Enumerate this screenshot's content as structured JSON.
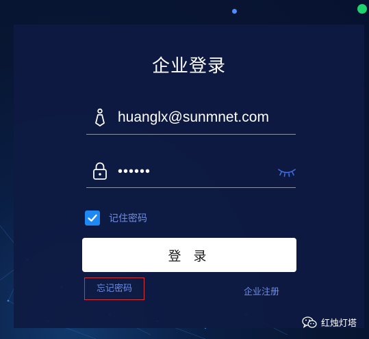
{
  "login": {
    "title": "企业登录",
    "username": {
      "value": "huanglx@sunmnet.com",
      "icon": "tie-user-icon"
    },
    "password": {
      "value": "••••••",
      "icon": "lock-icon",
      "toggle_icon": "eye-closed-icon"
    },
    "remember": {
      "label": "记住密码",
      "checked": true
    },
    "submit_label": "登 录",
    "forgot_label": "忘记密码",
    "register_label": "企业注册"
  },
  "watermark": {
    "label": "红烛灯塔",
    "icon": "wechat-icon"
  },
  "colors": {
    "background": "#081633",
    "card": "#0e1a42",
    "accent_link": "#6f8de6",
    "checkbox": "#1e88f5",
    "status_dot": "#1ed26d",
    "highlight_box": "#d8333a"
  }
}
